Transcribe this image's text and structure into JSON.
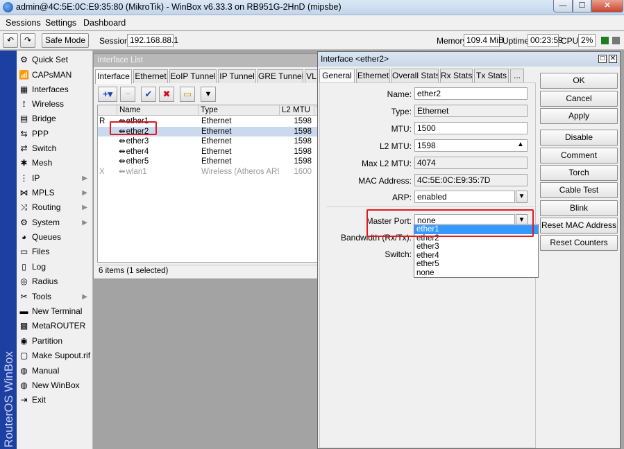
{
  "titlebar": {
    "title": "admin@4C:5E:0C:E9:35:80 (MikroTik) - WinBox v6.33.3 on RB951G-2HnD (mipsbe)",
    "min": "—",
    "max": "☐",
    "close": "✕"
  },
  "menu": [
    "Sessions",
    "Settings",
    "Dashboard"
  ],
  "toolbar": {
    "undo": "↶",
    "redo": "↷",
    "safe_mode": "Safe Mode",
    "session_label": "Session:",
    "session_value": "192.168.88.1",
    "memory_label": "Memory:",
    "memory_value": "109.4 MiB",
    "uptime_label": "Uptime:",
    "uptime_value": "00:23:59",
    "cpu_label": "CPU:",
    "cpu_value": "2%",
    "indicator_colors": [
      "#1e7d1e",
      "#777777"
    ]
  },
  "side_strip_text": "RouterOS WinBox",
  "sidebar": [
    {
      "label": "Quick Set",
      "icon": "quickset-icon",
      "glyph": "⚙",
      "submenu": false
    },
    {
      "label": "CAPsMAN",
      "icon": "capsman-icon",
      "glyph": "📶",
      "submenu": false
    },
    {
      "label": "Interfaces",
      "icon": "interfaces-icon",
      "glyph": "▦",
      "submenu": false
    },
    {
      "label": "Wireless",
      "icon": "wireless-icon",
      "glyph": "⟟",
      "submenu": false
    },
    {
      "label": "Bridge",
      "icon": "bridge-icon",
      "glyph": "▤",
      "submenu": false
    },
    {
      "label": "PPP",
      "icon": "ppp-icon",
      "glyph": "⇆",
      "submenu": false
    },
    {
      "label": "Switch",
      "icon": "switch-icon",
      "glyph": "⇄",
      "submenu": false
    },
    {
      "label": "Mesh",
      "icon": "mesh-icon",
      "glyph": "✱",
      "submenu": false
    },
    {
      "label": "IP",
      "icon": "ip-icon",
      "glyph": "⋮",
      "submenu": true
    },
    {
      "label": "MPLS",
      "icon": "mpls-icon",
      "glyph": "⋈",
      "submenu": true
    },
    {
      "label": "Routing",
      "icon": "routing-icon",
      "glyph": "⤨",
      "submenu": true
    },
    {
      "label": "System",
      "icon": "system-icon",
      "glyph": "⚙",
      "submenu": true
    },
    {
      "label": "Queues",
      "icon": "queues-icon",
      "glyph": "◕",
      "submenu": false
    },
    {
      "label": "Files",
      "icon": "files-icon",
      "glyph": "▭",
      "submenu": false
    },
    {
      "label": "Log",
      "icon": "log-icon",
      "glyph": "▯",
      "submenu": false
    },
    {
      "label": "Radius",
      "icon": "radius-icon",
      "glyph": "◎",
      "submenu": false
    },
    {
      "label": "Tools",
      "icon": "tools-icon",
      "glyph": "✂",
      "submenu": true
    },
    {
      "label": "New Terminal",
      "icon": "terminal-icon",
      "glyph": "▬",
      "submenu": false
    },
    {
      "label": "MetaROUTER",
      "icon": "metarouter-icon",
      "glyph": "▩",
      "submenu": false
    },
    {
      "label": "Partition",
      "icon": "partition-icon",
      "glyph": "◉",
      "submenu": false
    },
    {
      "label": "Make Supout.rif",
      "icon": "supout-icon",
      "glyph": "▢",
      "submenu": false
    },
    {
      "label": "Manual",
      "icon": "manual-icon",
      "glyph": "◍",
      "submenu": false
    },
    {
      "label": "New WinBox",
      "icon": "winbox-icon",
      "glyph": "◍",
      "submenu": false
    },
    {
      "label": "Exit",
      "icon": "exit-icon",
      "glyph": "⇥",
      "submenu": false
    }
  ],
  "iflist": {
    "title": "Interface List",
    "tabs": [
      "Interface",
      "Ethernet",
      "EoIP Tunnel",
      "IP Tunnel",
      "GRE Tunnel",
      "VL"
    ],
    "tools": {
      "add": "+▾",
      "remove": "−",
      "enable": "✔",
      "disable": "✖",
      "comment": "▭",
      "filter": "▼"
    },
    "columns": [
      "",
      "Name",
      "Type",
      "L2 MTU",
      "T"
    ],
    "rows": [
      {
        "flag": "R",
        "name": "ether1",
        "type": "Ethernet",
        "l2mtu": "1598",
        "selected": false,
        "disabled": false
      },
      {
        "flag": "",
        "name": "ether2",
        "type": "Ethernet",
        "l2mtu": "1598",
        "selected": true,
        "disabled": false
      },
      {
        "flag": "",
        "name": "ether3",
        "type": "Ethernet",
        "l2mtu": "1598",
        "selected": false,
        "disabled": false
      },
      {
        "flag": "",
        "name": "ether4",
        "type": "Ethernet",
        "l2mtu": "1598",
        "selected": false,
        "disabled": false
      },
      {
        "flag": "",
        "name": "ether5",
        "type": "Ethernet",
        "l2mtu": "1598",
        "selected": false,
        "disabled": false
      },
      {
        "flag": "X",
        "name": "wlan1",
        "type": "Wireless (Atheros AR9...",
        "l2mtu": "1600",
        "selected": false,
        "disabled": true
      }
    ],
    "status": "6 items (1 selected)"
  },
  "ifwin": {
    "title": "Interface <ether2>",
    "tabs": [
      "General",
      "Ethernet",
      "Overall Stats",
      "Rx Stats",
      "Tx Stats",
      "..."
    ],
    "fields": {
      "name_label": "Name:",
      "name_value": "ether2",
      "type_label": "Type:",
      "type_value": "Ethernet",
      "mtu_label": "MTU:",
      "mtu_value": "1500",
      "l2mtu_label": "L2 MTU:",
      "l2mtu_value": "1598",
      "maxl2mtu_label": "Max L2 MTU:",
      "maxl2mtu_value": "4074",
      "mac_label": "MAC Address:",
      "mac_value": "4C:5E:0C:E9:35:7D",
      "arp_label": "ARP:",
      "arp_value": "enabled",
      "master_label": "Master Port:",
      "master_value": "none",
      "bandwidth_label": "Bandwidth (Rx/Tx):",
      "switch_label": "Switch:"
    },
    "dropdown_options": [
      "ether1",
      "ether2",
      "ether3",
      "ether4",
      "ether5",
      "none"
    ],
    "dropdown_highlight": "ether1",
    "buttons": [
      "OK",
      "Cancel",
      "Apply",
      "Disable",
      "Comment",
      "Torch",
      "Cable Test",
      "Blink",
      "Reset MAC Address",
      "Reset Counters"
    ]
  },
  "colors": {
    "accent": "#1c3fa2",
    "selection": "#cbd9ee",
    "highlight": "#3399ff",
    "annotation": "#e0191f"
  }
}
